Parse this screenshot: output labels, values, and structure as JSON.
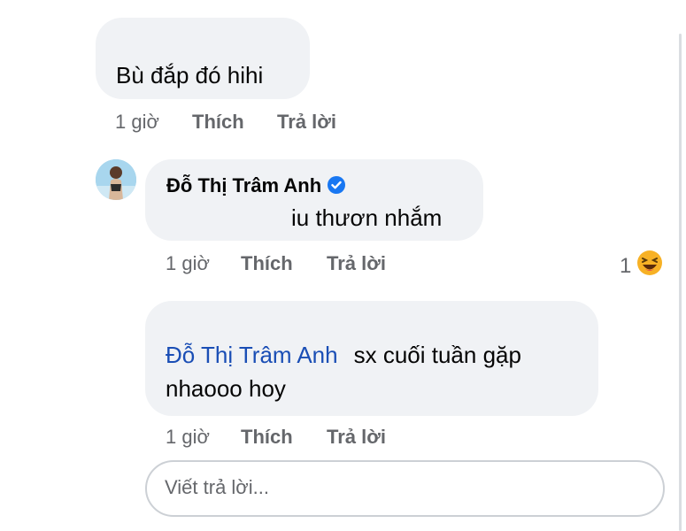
{
  "comment1": {
    "text": "Bù đắp đó hihi",
    "time": "1 giờ",
    "like_label": "Thích",
    "reply_label": "Trả lời"
  },
  "comment2": {
    "author": "Đỗ Thị Trâm Anh",
    "text": "iu thươn nhắm",
    "time": "1 giờ",
    "like_label": "Thích",
    "reply_label": "Trả lời",
    "reaction_count": "1",
    "reaction_icon": "laughing-emoji-icon"
  },
  "comment3": {
    "mention": "Đỗ Thị Trâm Anh",
    "text": "sx cuối tuần gặp nhaooo hoy",
    "time": "1 giờ",
    "like_label": "Thích",
    "reply_label": "Trả lời"
  },
  "reply_input": {
    "placeholder": "Viết trả lời..."
  },
  "colors": {
    "bubble": "#f0f2f5",
    "meta_text": "#65676b",
    "mention": "#1a4eb5",
    "verified_badge": "#1877f2",
    "reaction": "#f7b125"
  }
}
